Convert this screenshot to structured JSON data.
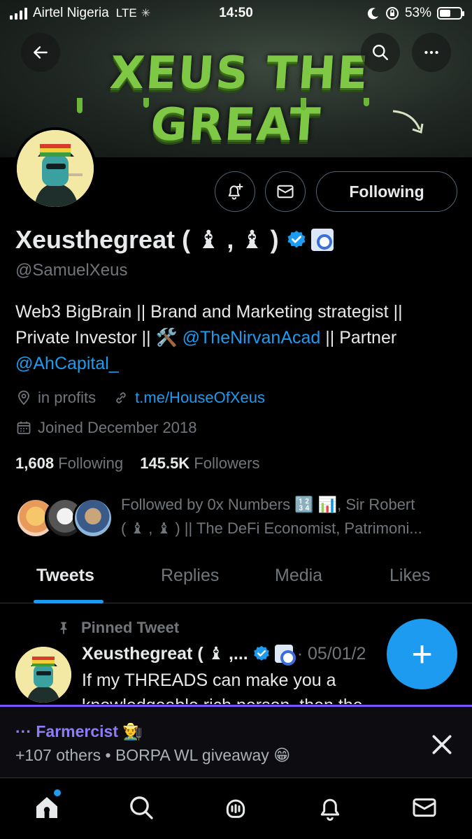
{
  "status_bar": {
    "carrier": "Airtel Nigeria",
    "network": "LTE",
    "time": "14:50",
    "battery": "53%",
    "battery_level": 0.53
  },
  "banner": {
    "title": "XEUS THE GREAT"
  },
  "header": {
    "back_icon": "back-arrow-icon",
    "search_icon": "search-icon",
    "more_icon": "more-icon"
  },
  "profile": {
    "display_name": "Xeusthegreat ( ♝ , ♝ )",
    "handle": "@SamuelXeus",
    "bio_part1": "Web3 BigBrain || Brand and Marketing strategist || Private Investor || 🛠️ ",
    "bio_link1": "@TheNirvanAcad",
    "bio_part2": " || Partner ",
    "bio_link2": "@AhCapital_",
    "location": "in profits",
    "website": "t.me/HouseOfXeus",
    "joined": "Joined December 2018",
    "following_count": "1,608",
    "following_label": "Following",
    "followers_count": "145.5K",
    "followers_label": "Followers",
    "following_button": "Following",
    "followed_by_line1": "Followed by 0x Numbers 🔢 📊, Sir Robert",
    "followed_by_line2": "( ♝ , ♝ ) || The DeFi Economist, Patrimoni..."
  },
  "tabs": [
    {
      "label": "Tweets",
      "active": true
    },
    {
      "label": "Replies",
      "active": false
    },
    {
      "label": "Media",
      "active": false
    },
    {
      "label": "Likes",
      "active": false
    }
  ],
  "pinned_tweet": {
    "label": "Pinned Tweet",
    "author": "Xeusthegreat ( ♝ ,...",
    "date": "· 05/01/2",
    "text": "If my THREADS can make you a knowledgeable rich person, then the"
  },
  "fab": {
    "label": "+"
  },
  "space": {
    "host": "··· Farmercist 👨‍🌾",
    "subtitle": "+107 others • BORPA WL giveaway 😁"
  },
  "colors": {
    "accent": "#1d9bf0",
    "space_purple": "#7856ff",
    "muted": "#71767b"
  }
}
